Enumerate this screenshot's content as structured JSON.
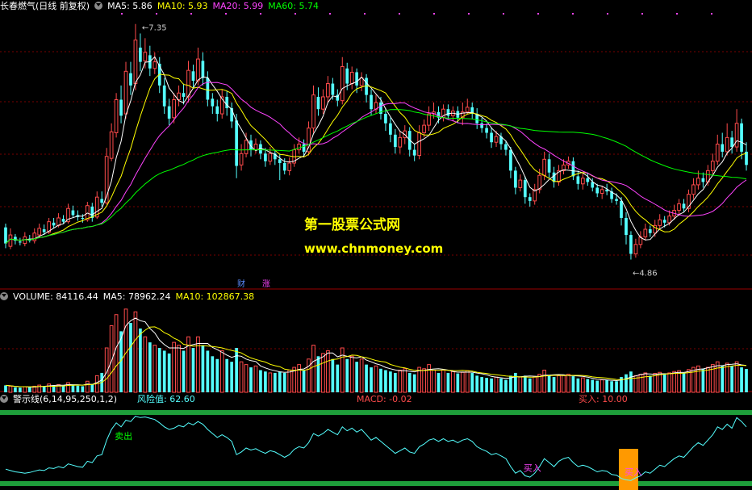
{
  "header": {
    "stock_name": "长春燃气(日线 前复权)",
    "ma5": "MA5: 5.86",
    "ma10": "MA10: 5.93",
    "ma20": "MA20: 5.99",
    "ma60": "MA60: 5.74"
  },
  "volume_header": {
    "volume": "VOLUME: 84116.44",
    "ma5": "MA5: 78962.24",
    "ma10": "MA10: 102867.38"
  },
  "indicator_header": {
    "name": "警示线(6,14,95,250,1,2)",
    "risk": "风险值: 62.60",
    "macd": "MACD: -0.02",
    "buy": "买入: 10.00"
  },
  "watermark": {
    "line1": "第一股票公式网",
    "line2": "www.chnmoney.com"
  },
  "colors": {
    "up": "#ff4b4b",
    "down": "#54ffff",
    "ma5": "#ffffff",
    "ma10": "#ffff00",
    "ma20": "#ff44ff",
    "ma60": "#00ff00",
    "risk_line": "#54ffff",
    "band": "#1e9e3a",
    "buy_bar": "#ff9900",
    "watermark": "#ffff00"
  },
  "chart_data": {
    "type": "candlestick",
    "price_range": [
      4.6,
      7.45
    ],
    "high_label": "7.35",
    "low_label": "4.86",
    "events": [
      "财",
      "涨"
    ],
    "sell_label": "卖出",
    "buy_label": "买入",
    "candles": [
      [
        5.2,
        5.03,
        5.24,
        4.98
      ],
      [
        5.0,
        5.12,
        5.19,
        4.97
      ],
      [
        5.1,
        5.06,
        5.13,
        5.02
      ],
      [
        5.05,
        5.04,
        5.09,
        5.01
      ],
      [
        5.03,
        5.1,
        5.15,
        5.0
      ],
      [
        5.08,
        5.06,
        5.12,
        5.04
      ],
      [
        5.06,
        5.14,
        5.19,
        5.03
      ],
      [
        5.12,
        5.19,
        5.24,
        5.1
      ],
      [
        5.18,
        5.15,
        5.23,
        5.12
      ],
      [
        5.15,
        5.26,
        5.3,
        5.13
      ],
      [
        5.25,
        5.22,
        5.3,
        5.19
      ],
      [
        5.22,
        5.3,
        5.35,
        5.2
      ],
      [
        5.29,
        5.26,
        5.33,
        5.24
      ],
      [
        5.26,
        5.4,
        5.45,
        5.24
      ],
      [
        5.38,
        5.33,
        5.43,
        5.3
      ],
      [
        5.33,
        5.31,
        5.38,
        5.27
      ],
      [
        5.3,
        5.29,
        5.34,
        5.25
      ],
      [
        5.28,
        5.43,
        5.47,
        5.26
      ],
      [
        5.42,
        5.3,
        5.46,
        5.26
      ],
      [
        5.31,
        5.52,
        5.58,
        5.29
      ],
      [
        5.5,
        5.46,
        5.58,
        5.42
      ],
      [
        5.46,
        5.95,
        6.04,
        5.44
      ],
      [
        5.93,
        6.21,
        6.3,
        5.9
      ],
      [
        6.2,
        6.55,
        6.62,
        6.15
      ],
      [
        6.55,
        6.38,
        6.7,
        6.3
      ],
      [
        6.4,
        6.85,
        6.95,
        6.35
      ],
      [
        6.83,
        6.7,
        6.95,
        6.6
      ],
      [
        6.72,
        7.18,
        7.35,
        6.65
      ],
      [
        7.1,
        6.95,
        7.25,
        6.85
      ],
      [
        6.96,
        7.05,
        7.2,
        6.88
      ],
      [
        7.02,
        6.88,
        7.12,
        6.8
      ],
      [
        6.88,
        6.95,
        7.05,
        6.82
      ],
      [
        6.93,
        6.7,
        7.0,
        6.62
      ],
      [
        6.7,
        6.48,
        6.78,
        6.4
      ],
      [
        6.48,
        6.35,
        6.56,
        6.28
      ],
      [
        6.36,
        6.55,
        6.62,
        6.3
      ],
      [
        6.55,
        6.62,
        6.7,
        6.48
      ],
      [
        6.62,
        6.58,
        6.72,
        6.5
      ],
      [
        6.58,
        6.86,
        6.96,
        6.52
      ],
      [
        6.85,
        6.75,
        6.92,
        6.68
      ],
      [
        6.75,
        6.98,
        7.1,
        6.7
      ],
      [
        6.96,
        6.78,
        7.05,
        6.7
      ],
      [
        6.78,
        6.55,
        6.85,
        6.48
      ],
      [
        6.56,
        6.48,
        6.62,
        6.4
      ],
      [
        6.48,
        6.4,
        6.55,
        6.32
      ],
      [
        6.4,
        6.58,
        6.66,
        6.35
      ],
      [
        6.58,
        6.46,
        6.64,
        6.38
      ],
      [
        6.46,
        6.32,
        6.52,
        6.25
      ],
      [
        6.33,
        5.85,
        6.4,
        5.72
      ],
      [
        5.86,
        5.98,
        6.08,
        5.8
      ],
      [
        5.98,
        6.12,
        6.2,
        5.94
      ],
      [
        6.12,
        6.02,
        6.18,
        5.95
      ],
      [
        6.02,
        6.08,
        6.14,
        5.98
      ],
      [
        6.08,
        5.98,
        6.12,
        5.92
      ],
      [
        5.98,
        5.9,
        6.04,
        5.84
      ],
      [
        5.9,
        5.98,
        6.05,
        5.86
      ],
      [
        5.98,
        5.92,
        6.02,
        5.86
      ],
      [
        5.92,
        5.88,
        5.98,
        5.7
      ],
      [
        5.88,
        5.8,
        5.93,
        5.76
      ],
      [
        5.8,
        5.88,
        5.94,
        5.75
      ],
      [
        5.88,
        6.02,
        6.08,
        5.84
      ],
      [
        6.02,
        6.08,
        6.15,
        5.98
      ],
      [
        6.08,
        6.0,
        6.13,
        5.95
      ],
      [
        6.0,
        6.25,
        6.32,
        5.96
      ],
      [
        6.25,
        6.6,
        6.7,
        6.2
      ],
      [
        6.58,
        6.45,
        6.68,
        6.38
      ],
      [
        6.45,
        6.58,
        6.66,
        6.4
      ],
      [
        6.58,
        6.72,
        6.8,
        6.52
      ],
      [
        6.72,
        6.6,
        6.78,
        6.55
      ],
      [
        6.6,
        6.54,
        6.66,
        6.48
      ],
      [
        6.54,
        6.9,
        7.0,
        6.5
      ],
      [
        6.88,
        6.72,
        6.94,
        6.65
      ],
      [
        6.72,
        6.84,
        6.9,
        6.66
      ],
      [
        6.84,
        6.7,
        6.88,
        6.62
      ],
      [
        6.7,
        6.78,
        6.84,
        6.64
      ],
      [
        6.78,
        6.6,
        6.82,
        6.52
      ],
      [
        6.6,
        6.45,
        6.66,
        6.38
      ],
      [
        6.45,
        6.52,
        6.6,
        6.4
      ],
      [
        6.52,
        6.4,
        6.58,
        6.34
      ],
      [
        6.4,
        6.3,
        6.46,
        6.22
      ],
      [
        6.3,
        6.18,
        6.36,
        6.1
      ],
      [
        6.18,
        6.05,
        6.24,
        5.98
      ],
      [
        6.05,
        6.15,
        6.22,
        5.98
      ],
      [
        6.15,
        6.22,
        6.28,
        6.08
      ],
      [
        6.22,
        6.02,
        6.26,
        5.95
      ],
      [
        6.02,
        5.96,
        6.08,
        5.9
      ],
      [
        5.96,
        6.2,
        6.28,
        5.92
      ],
      [
        6.2,
        6.28,
        6.34,
        6.15
      ],
      [
        6.28,
        6.4,
        6.48,
        6.22
      ],
      [
        6.4,
        6.42,
        6.52,
        6.35
      ],
      [
        6.42,
        6.36,
        6.48,
        6.3
      ],
      [
        6.36,
        6.45,
        6.5,
        6.32
      ],
      [
        6.45,
        6.38,
        6.5,
        6.34
      ],
      [
        6.38,
        6.43,
        6.48,
        6.32
      ],
      [
        6.43,
        6.36,
        6.48,
        6.3
      ],
      [
        6.36,
        6.42,
        6.52,
        6.28
      ],
      [
        6.42,
        6.47,
        6.56,
        6.4
      ],
      [
        6.47,
        6.4,
        6.52,
        6.35
      ],
      [
        6.4,
        6.3,
        6.46,
        6.24
      ],
      [
        6.3,
        6.25,
        6.36,
        6.2
      ],
      [
        6.25,
        6.2,
        6.3,
        6.14
      ],
      [
        6.2,
        6.1,
        6.26,
        6.04
      ],
      [
        6.1,
        6.16,
        6.22,
        6.05
      ],
      [
        6.16,
        6.08,
        6.2,
        6.02
      ],
      [
        6.08,
        6.02,
        6.12,
        5.96
      ],
      [
        6.02,
        5.8,
        6.05,
        5.72
      ],
      [
        5.8,
        5.62,
        5.84,
        5.55
      ],
      [
        5.62,
        5.7,
        5.76,
        5.58
      ],
      [
        5.7,
        5.52,
        5.74,
        5.45
      ],
      [
        5.52,
        5.48,
        5.56,
        5.42
      ],
      [
        5.48,
        5.6,
        5.66,
        5.44
      ],
      [
        5.6,
        5.75,
        5.82,
        5.56
      ],
      [
        5.75,
        5.92,
        6.0,
        5.7
      ],
      [
        5.92,
        5.78,
        5.98,
        5.72
      ],
      [
        5.78,
        5.68,
        5.84,
        5.62
      ],
      [
        5.68,
        5.8,
        5.86,
        5.64
      ],
      [
        5.8,
        5.86,
        5.92,
        5.76
      ],
      [
        5.86,
        5.9,
        5.95,
        5.82
      ],
      [
        5.9,
        5.74,
        5.94,
        5.7
      ],
      [
        5.74,
        5.66,
        5.8,
        5.6
      ],
      [
        5.66,
        5.72,
        5.78,
        5.6
      ],
      [
        5.72,
        5.68,
        5.78,
        5.64
      ],
      [
        5.68,
        5.62,
        5.72,
        5.58
      ],
      [
        5.62,
        5.56,
        5.66,
        5.52
      ],
      [
        5.56,
        5.6,
        5.64,
        5.5
      ],
      [
        5.6,
        5.58,
        5.66,
        5.54
      ],
      [
        5.58,
        5.5,
        5.62,
        5.46
      ],
      [
        5.5,
        5.48,
        5.56,
        5.44
      ],
      [
        5.48,
        5.3,
        5.52,
        5.22
      ],
      [
        5.3,
        5.12,
        5.36,
        5.02
      ],
      [
        5.12,
        4.92,
        5.16,
        4.86
      ],
      [
        4.92,
        5.02,
        5.08,
        4.88
      ],
      [
        5.02,
        5.1,
        5.16,
        4.98
      ],
      [
        5.1,
        5.18,
        5.24,
        5.06
      ],
      [
        5.18,
        5.14,
        5.22,
        5.1
      ],
      [
        5.14,
        5.22,
        5.28,
        5.1
      ],
      [
        5.22,
        5.28,
        5.34,
        5.18
      ],
      [
        5.28,
        5.25,
        5.32,
        5.2
      ],
      [
        5.25,
        5.32,
        5.38,
        5.22
      ],
      [
        5.32,
        5.38,
        5.44,
        5.28
      ],
      [
        5.38,
        5.45,
        5.5,
        5.32
      ],
      [
        5.45,
        5.4,
        5.5,
        5.36
      ],
      [
        5.4,
        5.55,
        5.6,
        5.36
      ],
      [
        5.55,
        5.65,
        5.72,
        5.5
      ],
      [
        5.65,
        5.72,
        5.8,
        5.6
      ],
      [
        5.72,
        5.68,
        5.78,
        5.62
      ],
      [
        5.68,
        5.8,
        5.86,
        5.64
      ],
      [
        5.8,
        5.9,
        5.98,
        5.76
      ],
      [
        5.9,
        6.08,
        6.18,
        5.86
      ],
      [
        6.08,
        6.0,
        6.2,
        5.94
      ],
      [
        6.0,
        6.15,
        6.3,
        5.96
      ],
      [
        6.15,
        6.05,
        6.22,
        5.98
      ],
      [
        6.05,
        6.3,
        6.45,
        6.0
      ],
      [
        6.3,
        6.0,
        6.35,
        5.92
      ],
      [
        6.0,
        5.86,
        6.1,
        5.8
      ]
    ],
    "volume_range": [
      0,
      320000
    ],
    "volumes": [
      25000,
      22000,
      18000,
      17000,
      20000,
      18000,
      22000,
      26000,
      21000,
      30000,
      25000,
      28000,
      22000,
      35000,
      27000,
      24000,
      22000,
      40000,
      30000,
      60000,
      70000,
      160000,
      240000,
      280000,
      220000,
      300000,
      250000,
      290000,
      230000,
      200000,
      180000,
      170000,
      160000,
      150000,
      140000,
      180000,
      170000,
      150000,
      200000,
      160000,
      200000,
      170000,
      150000,
      130000,
      120000,
      150000,
      120000,
      110000,
      160000,
      110000,
      100000,
      90000,
      95000,
      80000,
      75000,
      70000,
      70000,
      75000,
      70000,
      80000,
      90000,
      100000,
      80000,
      120000,
      170000,
      130000,
      140000,
      150000,
      120000,
      100000,
      160000,
      120000,
      130000,
      110000,
      120000,
      100000,
      90000,
      95000,
      85000,
      80000,
      75000,
      70000,
      80000,
      85000,
      70000,
      65000,
      90000,
      85000,
      100000,
      80000,
      70000,
      80000,
      70000,
      75000,
      68000,
      72000,
      78000,
      70000,
      60000,
      55000,
      52000,
      50000,
      55000,
      50000,
      45000,
      60000,
      70000,
      55000,
      60000,
      50000,
      55000,
      65000,
      80000,
      60000,
      55000,
      60000,
      62000,
      65000,
      58000,
      50000,
      52000,
      48000,
      45000,
      42000,
      45000,
      44000,
      40000,
      40000,
      55000,
      65000,
      75000,
      60000,
      65000,
      70000,
      60000,
      68000,
      72000,
      65000,
      70000,
      75000,
      78000,
      70000,
      82000,
      90000,
      95000,
      85000,
      90000,
      100000,
      110000,
      95000,
      105000,
      95000,
      110000,
      90000,
      84116
    ],
    "risk_range": [
      0,
      100
    ],
    "risk": [
      18,
      16,
      14,
      13,
      12,
      13,
      15,
      17,
      16,
      20,
      19,
      22,
      20,
      26,
      24,
      22,
      21,
      30,
      28,
      38,
      40,
      62,
      78,
      88,
      82,
      92,
      90,
      98,
      96,
      97,
      95,
      93,
      88,
      82,
      78,
      80,
      84,
      82,
      88,
      85,
      90,
      86,
      78,
      72,
      66,
      70,
      66,
      60,
      40,
      44,
      50,
      47,
      49,
      45,
      42,
      46,
      44,
      40,
      36,
      40,
      48,
      52,
      50,
      58,
      72,
      68,
      72,
      78,
      74,
      70,
      82,
      76,
      80,
      74,
      78,
      70,
      62,
      66,
      60,
      54,
      48,
      42,
      46,
      50,
      44,
      42,
      52,
      56,
      62,
      64,
      60,
      64,
      60,
      62,
      58,
      62,
      64,
      60,
      52,
      48,
      45,
      40,
      42,
      38,
      34,
      22,
      12,
      16,
      8,
      6,
      12,
      22,
      34,
      28,
      22,
      30,
      34,
      36,
      28,
      22,
      24,
      22,
      18,
      14,
      16,
      15,
      10,
      9,
      4,
      2,
      1,
      5,
      8,
      14,
      12,
      18,
      24,
      22,
      28,
      34,
      38,
      36,
      44,
      52,
      58,
      54,
      62,
      70,
      82,
      78,
      86,
      80,
      96,
      90,
      82
    ],
    "buy_signals": [
      108,
      129,
      130
    ],
    "sell_signals": [
      23
    ]
  }
}
